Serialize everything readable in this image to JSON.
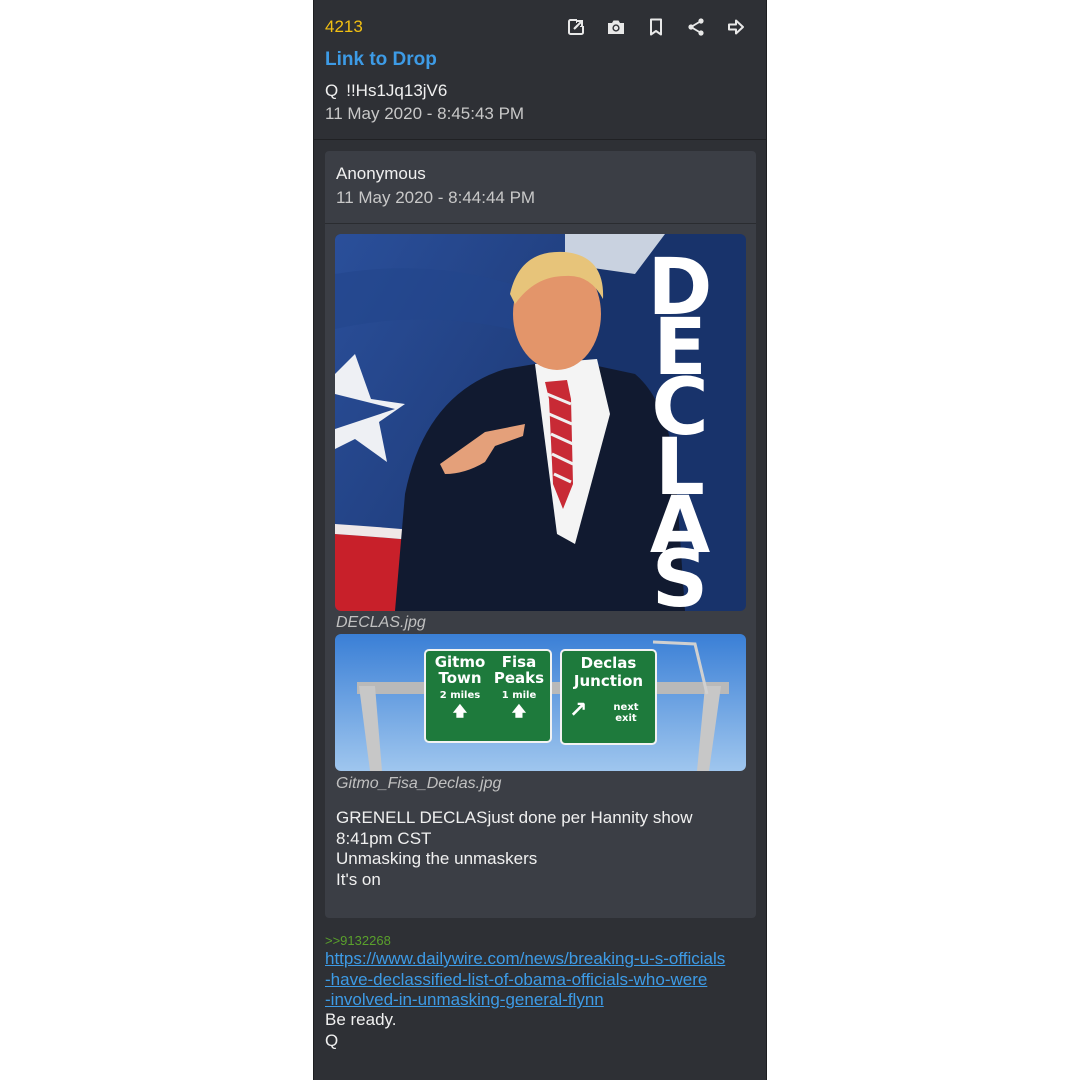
{
  "drop": {
    "number": "4213",
    "link_label": "Link to Drop",
    "author_name": "Q",
    "tripcode": "!!Hs1Jq13jV6",
    "date": "11 May 2020 - 8:45:43 PM"
  },
  "toolbar": {
    "icons": [
      "open-external-icon",
      "camera-icon",
      "bookmark-icon",
      "share-icon",
      "forward-icon"
    ]
  },
  "quoted_post": {
    "author": "Anonymous",
    "date": "11 May 2020 - 8:44:44 PM",
    "images": [
      {
        "filename": "DECLAS.jpg",
        "overlay_text": "DECLAS"
      },
      {
        "filename": "Gitmo_Fisa_Declas.jpg",
        "signs": [
          {
            "line1": "Gitmo",
            "line2": "Town",
            "distance": "2 miles"
          },
          {
            "line1": "Fisa",
            "line2": "Peaks",
            "distance": "1 mile"
          },
          {
            "line1": "Declas",
            "line2": "Junction",
            "distance": "next exit"
          }
        ]
      }
    ],
    "text_lines": [
      "GRENELL DECLASjust done per Hannity show",
      "8:41pm CST",
      "Unmasking the unmaskers",
      "It's on"
    ]
  },
  "reply_ref": ">>9132268",
  "url_lines": [
    "https://www.dailywire.com/news/breaking-u-s-officials",
    "-have-declassified-list-of-obama-officials-who-were",
    "-involved-in-unmasking-general-flynn"
  ],
  "body_lines": [
    "Be ready.",
    "Q"
  ],
  "colors": {
    "background": "#2e3035",
    "quote_bg": "#3b3e45",
    "number": "#f2c012",
    "link": "#3d9be6",
    "reply_ref": "#5aa02c",
    "sign_green": "#1e7a3c"
  }
}
